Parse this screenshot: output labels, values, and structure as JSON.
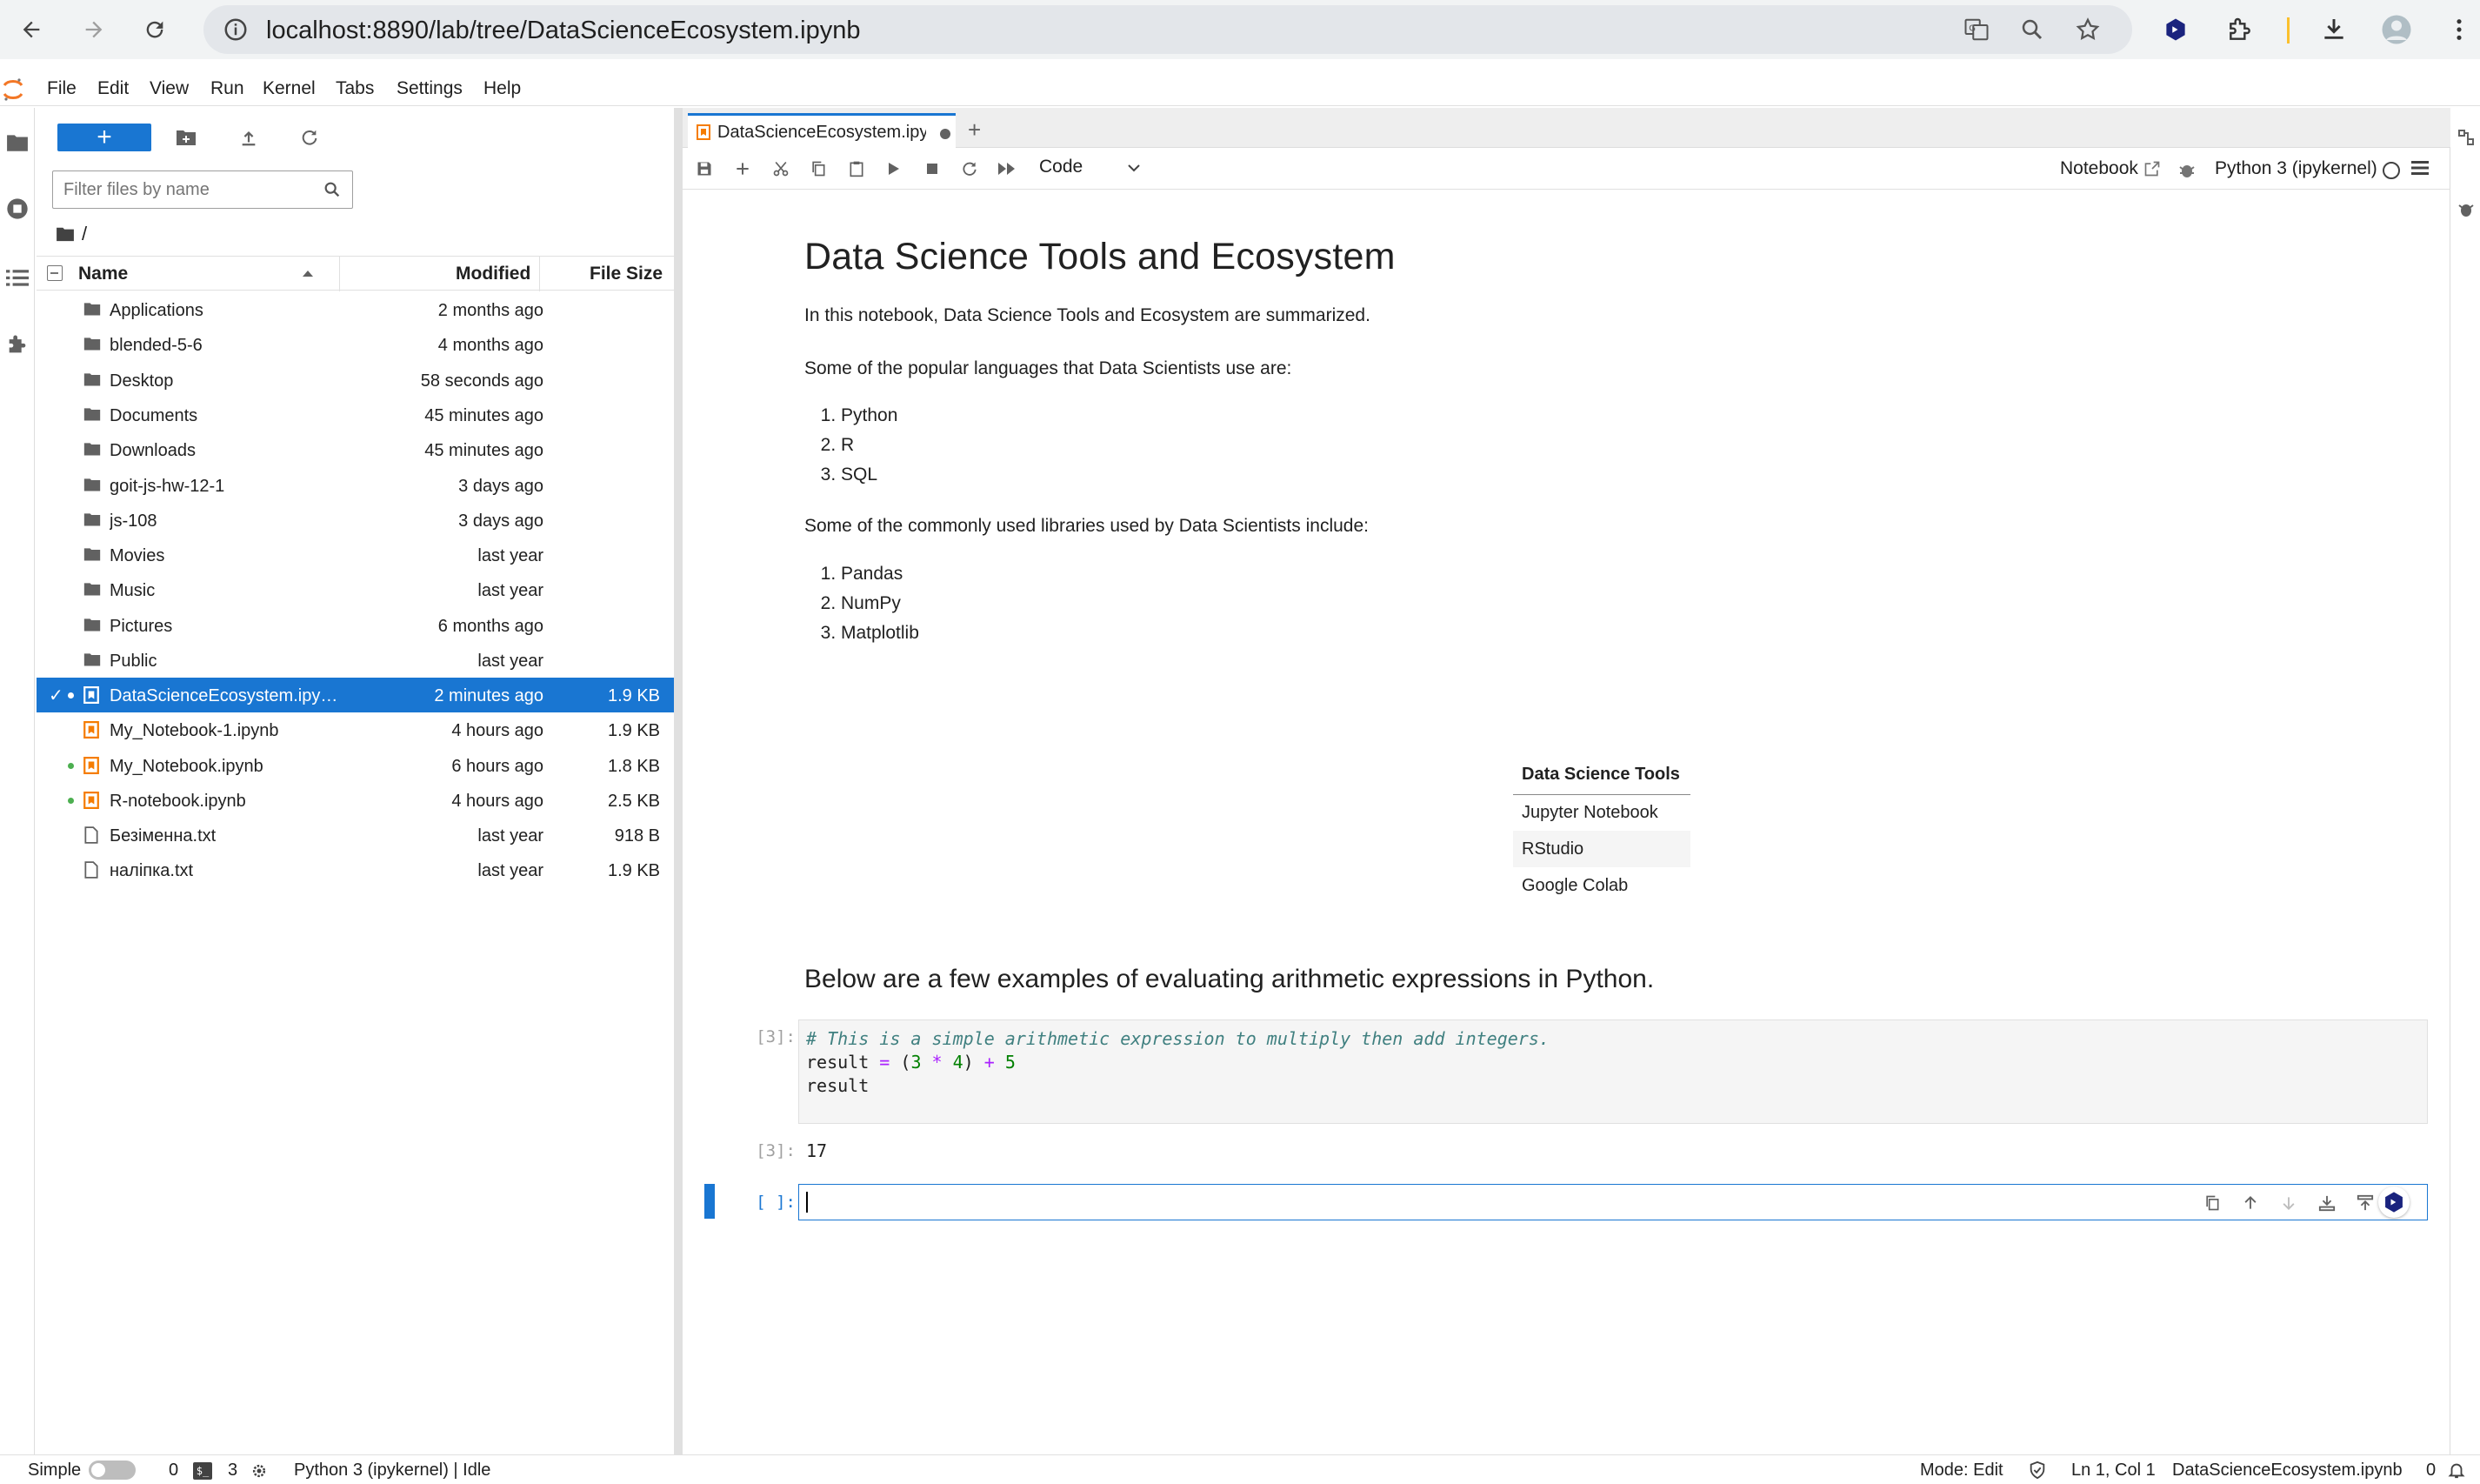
{
  "browser": {
    "url": "localhost:8890/lab/tree/DataScienceEcosystem.ipynb"
  },
  "menubar": {
    "items": [
      "File",
      "Edit",
      "View",
      "Run",
      "Kernel",
      "Tabs",
      "Settings",
      "Help"
    ]
  },
  "filebrowser": {
    "new_label": "+",
    "filter_placeholder": "Filter files by name",
    "breadcrumb": "/",
    "columns": {
      "name": "Name",
      "modified": "Modified",
      "size": "File Size"
    },
    "rows": [
      {
        "name": "Applications",
        "modified": "2 months ago",
        "size": "",
        "type": "folder"
      },
      {
        "name": "blended-5-6",
        "modified": "4 months ago",
        "size": "",
        "type": "folder"
      },
      {
        "name": "Desktop",
        "modified": "58 seconds ago",
        "size": "",
        "type": "folder"
      },
      {
        "name": "Documents",
        "modified": "45 minutes ago",
        "size": "",
        "type": "folder"
      },
      {
        "name": "Downloads",
        "modified": "45 minutes ago",
        "size": "",
        "type": "folder"
      },
      {
        "name": "goit-js-hw-12-1",
        "modified": "3 days ago",
        "size": "",
        "type": "folder"
      },
      {
        "name": "js-108",
        "modified": "3 days ago",
        "size": "",
        "type": "folder"
      },
      {
        "name": "Movies",
        "modified": "last year",
        "size": "",
        "type": "folder"
      },
      {
        "name": "Music",
        "modified": "last year",
        "size": "",
        "type": "folder"
      },
      {
        "name": "Pictures",
        "modified": "6 months ago",
        "size": "",
        "type": "folder"
      },
      {
        "name": "Public",
        "modified": "last year",
        "size": "",
        "type": "folder"
      },
      {
        "name": "DataScienceEcosystem.ipy…",
        "modified": "2 minutes ago",
        "size": "1.9 KB",
        "type": "notebook"
      },
      {
        "name": "My_Notebook-1.ipynb",
        "modified": "4 hours ago",
        "size": "1.9 KB",
        "type": "notebook"
      },
      {
        "name": "My_Notebook.ipynb",
        "modified": "6 hours ago",
        "size": "1.8 KB",
        "type": "notebook"
      },
      {
        "name": "R-notebook.ipynb",
        "modified": "4 hours ago",
        "size": "2.5 KB",
        "type": "notebook"
      },
      {
        "name": "Безіменна.txt",
        "modified": "last year",
        "size": "918 B",
        "type": "file"
      },
      {
        "name": "налiпка.txt",
        "modified": "last year",
        "size": "1.9 KB",
        "type": "file"
      }
    ]
  },
  "notebook": {
    "tab_label": "DataScienceEcosystem.ipynb",
    "cell_type": "Code",
    "notebook_link": "Notebook",
    "kernel": "Python 3 (ipykernel)",
    "title": "Data Science Tools and Ecosystem",
    "intro": "In this notebook, Data Science Tools and Ecosystem are summarized.",
    "languages_intro": "Some of the popular languages that Data Scientists use are:",
    "languages": [
      "Python",
      "R",
      "SQL"
    ],
    "libraries_intro": "Some of the commonly used libraries used by Data Scientists include:",
    "libraries": [
      "Pandas",
      "NumPy",
      "Matplotlib"
    ],
    "table_header": "Data Science Tools",
    "tools": [
      "Jupyter Notebook",
      "RStudio",
      "Google Colab"
    ],
    "examples_heading": "Below are a few examples of evaluating arithmetic expressions in Python.",
    "code_prompt": "[3]:",
    "code_comment": "# This is a simple arithmetic expression to multiply then add integers.",
    "code_line2_a": "result ",
    "code_line2_eq": "=",
    "code_line2_b": " (",
    "code_num1": "3",
    "code_op1": " * ",
    "code_num2": "4",
    "code_line2_c": ") ",
    "code_op2": "+",
    "code_num3": " 5",
    "code_line3": "result",
    "output_prompt": "[3]:",
    "output_value": "17",
    "empty_prompt": "[ ]:"
  },
  "statusbar": {
    "mode_label": "Simple",
    "terminals": "0",
    "kernels": "3",
    "kernel_status": "Python 3 (ipykernel) | Idle",
    "edit_mode": "Mode: Edit",
    "cursor": "Ln 1, Col 1",
    "filename": "DataScienceEcosystem.ipynb",
    "notifications": "0"
  },
  "colors": {
    "accent": "#1976d2",
    "selected_row": "#1976d2",
    "orange_icon": "#f57c00",
    "trusted_dot": "#4caf50"
  }
}
